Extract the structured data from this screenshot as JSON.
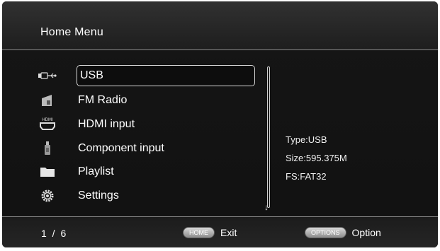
{
  "header": {
    "title": "Home Menu"
  },
  "menu": {
    "items": [
      {
        "label": "USB",
        "icon": "usb-icon",
        "selected": true
      },
      {
        "label": "FM Radio",
        "icon": "radio-icon",
        "selected": false
      },
      {
        "label": "HDMI input",
        "icon": "hdmi-icon",
        "selected": false
      },
      {
        "label": "Component input",
        "icon": "component-plug-icon",
        "selected": false
      },
      {
        "label": "Playlist",
        "icon": "folder-icon",
        "selected": false
      },
      {
        "label": "Settings",
        "icon": "gear-icon",
        "selected": false
      }
    ]
  },
  "info": {
    "type": "Type:USB",
    "size": "Size:595.375M",
    "fs": "FS:FAT32"
  },
  "footer": {
    "page": "1 / 6",
    "home_key": "HOME",
    "home_action": "Exit",
    "options_key": "OPTIONS",
    "options_action": "Option"
  }
}
